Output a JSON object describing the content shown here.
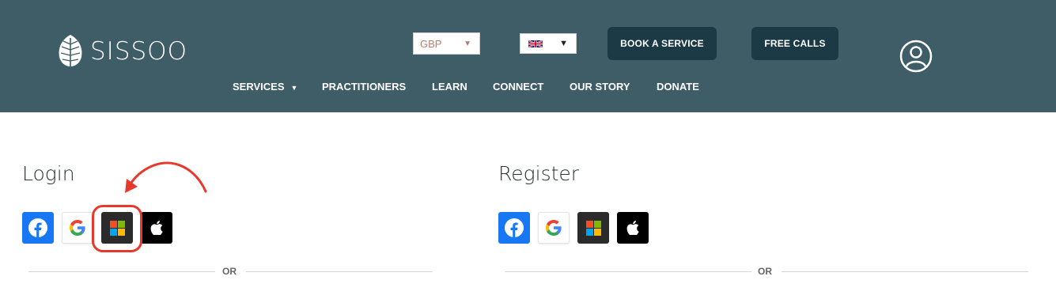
{
  "brand": {
    "name": "SISSOO",
    "icon": "leaf-logo-icon"
  },
  "header": {
    "currency": {
      "value": "GBP",
      "caret": "▼"
    },
    "language": {
      "flag": "uk-flag-icon",
      "caret": "▼"
    },
    "book_service_label": "BOOK A SERVICE",
    "free_calls_label": "FREE CALLS",
    "account_icon": "user-account-icon"
  },
  "nav": {
    "items": [
      {
        "label": "SERVICES",
        "has_dropdown": true
      },
      {
        "label": "PRACTITIONERS"
      },
      {
        "label": "LEARN"
      },
      {
        "label": "CONNECT"
      },
      {
        "label": "OUR STORY"
      },
      {
        "label": "DONATE"
      }
    ],
    "dropdown_caret": "▼"
  },
  "login": {
    "title": "Login",
    "social": [
      "facebook-icon",
      "google-icon",
      "microsoft-icon",
      "apple-icon"
    ],
    "or_label": "OR"
  },
  "register": {
    "title": "Register",
    "social": [
      "facebook-icon",
      "google-icon",
      "microsoft-icon",
      "apple-icon"
    ],
    "or_label": "OR"
  },
  "colors": {
    "header_bg": "#3f5d66",
    "button_dark": "#1c3a46",
    "facebook": "#1877f2",
    "annotation": "#e8382c"
  }
}
